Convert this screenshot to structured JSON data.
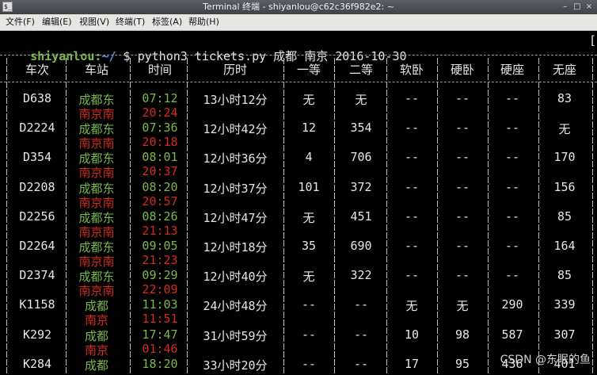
{
  "window": {
    "title": "Terminal 终端 - shiyanlou@c62c36f982e2: ~",
    "icon_glyph": "$_",
    "controls": [
      "–",
      "□",
      "×"
    ]
  },
  "menu": [
    "文件(F)",
    "编辑(E)",
    "视图(V)",
    "终端(T)",
    "标签(A)",
    "帮助(H)"
  ],
  "prompt": {
    "user": "shiyanlou:",
    "path": "~/",
    "symbol": "$",
    "command": "python3 tickets.py 成都 南京 2016-10-30",
    "cursor_char": "["
  },
  "headers": [
    "车次",
    "车站",
    "时间",
    "历时",
    "一等",
    "二等",
    "软卧",
    "硬卧",
    "硬座",
    "无座"
  ],
  "trains": [
    {
      "train": "D638",
      "from": "成都东",
      "to": "南京南",
      "depart": "07:12",
      "arrive": "20:24",
      "duration": "13小时12分",
      "first": "无",
      "second": "无",
      "soft_sleeper": "--",
      "hard_sleeper": "--",
      "hard_seat": "--",
      "no_seat": "83"
    },
    {
      "train": "D2224",
      "from": "成都东",
      "to": "南京南",
      "depart": "07:36",
      "arrive": "20:18",
      "duration": "12小时42分",
      "first": "12",
      "second": "354",
      "soft_sleeper": "--",
      "hard_sleeper": "--",
      "hard_seat": "--",
      "no_seat": "无"
    },
    {
      "train": "D354",
      "from": "成都东",
      "to": "南京南",
      "depart": "08:01",
      "arrive": "20:37",
      "duration": "12小时36分",
      "first": "4",
      "second": "706",
      "soft_sleeper": "--",
      "hard_sleeper": "--",
      "hard_seat": "--",
      "no_seat": "170"
    },
    {
      "train": "D2208",
      "from": "成都东",
      "to": "南京南",
      "depart": "08:20",
      "arrive": "20:57",
      "duration": "12小时37分",
      "first": "101",
      "second": "372",
      "soft_sleeper": "--",
      "hard_sleeper": "--",
      "hard_seat": "--",
      "no_seat": "156"
    },
    {
      "train": "D2256",
      "from": "成都东",
      "to": "南京南",
      "depart": "08:26",
      "arrive": "21:13",
      "duration": "12小时47分",
      "first": "无",
      "second": "451",
      "soft_sleeper": "--",
      "hard_sleeper": "--",
      "hard_seat": "--",
      "no_seat": "85"
    },
    {
      "train": "D2264",
      "from": "成都东",
      "to": "南京南",
      "depart": "09:05",
      "arrive": "21:23",
      "duration": "12小时18分",
      "first": "35",
      "second": "690",
      "soft_sleeper": "--",
      "hard_sleeper": "--",
      "hard_seat": "--",
      "no_seat": "164"
    },
    {
      "train": "D2374",
      "from": "成都东",
      "to": "南京南",
      "depart": "09:29",
      "arrive": "22:09",
      "duration": "12小时40分",
      "first": "无",
      "second": "322",
      "soft_sleeper": "--",
      "hard_sleeper": "--",
      "hard_seat": "--",
      "no_seat": "85"
    },
    {
      "train": "K1158",
      "from": "成都",
      "to": "南京",
      "depart": "11:03",
      "arrive": "11:51",
      "duration": "24小时48分",
      "first": "--",
      "second": "--",
      "soft_sleeper": "无",
      "hard_sleeper": "无",
      "hard_seat": "290",
      "no_seat": "339"
    },
    {
      "train": "K292",
      "from": "成都",
      "to": "南京",
      "depart": "17:47",
      "arrive": "01:46",
      "duration": "31小时59分",
      "first": "--",
      "second": "--",
      "soft_sleeper": "10",
      "hard_sleeper": "98",
      "hard_seat": "587",
      "no_seat": "307"
    },
    {
      "train": "K284",
      "from": "成都",
      "to": "",
      "depart": "18:20",
      "arrive": "",
      "duration": "33小时20分",
      "first": "--",
      "second": "--",
      "soft_sleeper": "17",
      "hard_sleeper": "95",
      "hard_seat": "436",
      "no_seat": "401"
    }
  ],
  "colors": {
    "depart": "#7ab84c",
    "arrive": "#d42a1f",
    "text": "#e6e6e6",
    "background": "#000000"
  },
  "watermark": "CSDN @东眠的鱼"
}
